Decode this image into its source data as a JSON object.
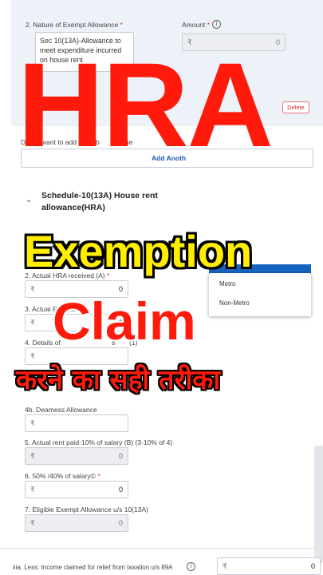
{
  "top_section": {
    "nature_label": "2.  Nature of Exempt Allowance",
    "required_mark": "*",
    "selected_allowance": "Sec 10(13A)-Allowance to meet expenditure incurred on house rent",
    "amount_label": "Amount",
    "amount_value": "0",
    "currency": "₹",
    "delete_label": "Delete"
  },
  "add_more": {
    "question_fragments": [
      "Do",
      "want to add more b",
      "value"
    ],
    "button_label": "Add Anoth"
  },
  "schedule": {
    "title": "Schedule-10(13A) House rent allowance(HRA)",
    "place_label_fragment": "M",
    "options": [
      "Metro",
      "Non-Metro"
    ]
  },
  "fields": [
    {
      "label": "2. Actual HRA received (A)",
      "required": true,
      "value": "0",
      "disabled": false
    },
    {
      "label_fragments": [
        "3. Actual R",
        "paid"
      ],
      "required": true,
      "value": "0",
      "disabled": false
    },
    {
      "label_fragments": [
        "4. Details of",
        "s",
        "(1)"
      ],
      "required": false,
      "value": "",
      "disabled": false
    },
    {
      "label": "4b. Deamess Allowance",
      "required": false,
      "value": "",
      "disabled": false
    },
    {
      "label": "5. Actual rent paid-10% of salary (B) (3-10% of 4)",
      "required": false,
      "value": "0",
      "disabled": true
    },
    {
      "label": "6. 50% /40% of salary©",
      "required": true,
      "value": "0",
      "disabled": false
    },
    {
      "label": "7. Eligible Exempt Allowance u/s 10(13A)",
      "required": false,
      "value": "0",
      "disabled": true
    }
  ],
  "bottom": {
    "label": "iiia. Less: Income claimed for relief from taxation u/s 89A",
    "value": "0"
  },
  "overlay": {
    "line1": "HRA",
    "line2": "Exemption",
    "line3": "Claim",
    "line4": "करने का सही तरीका"
  },
  "colors": {
    "panel_bg": "#edf2f9",
    "accent_blue": "#1565c0",
    "overlay_red": "#ff1a0c",
    "overlay_yellow": "#ffee00"
  }
}
